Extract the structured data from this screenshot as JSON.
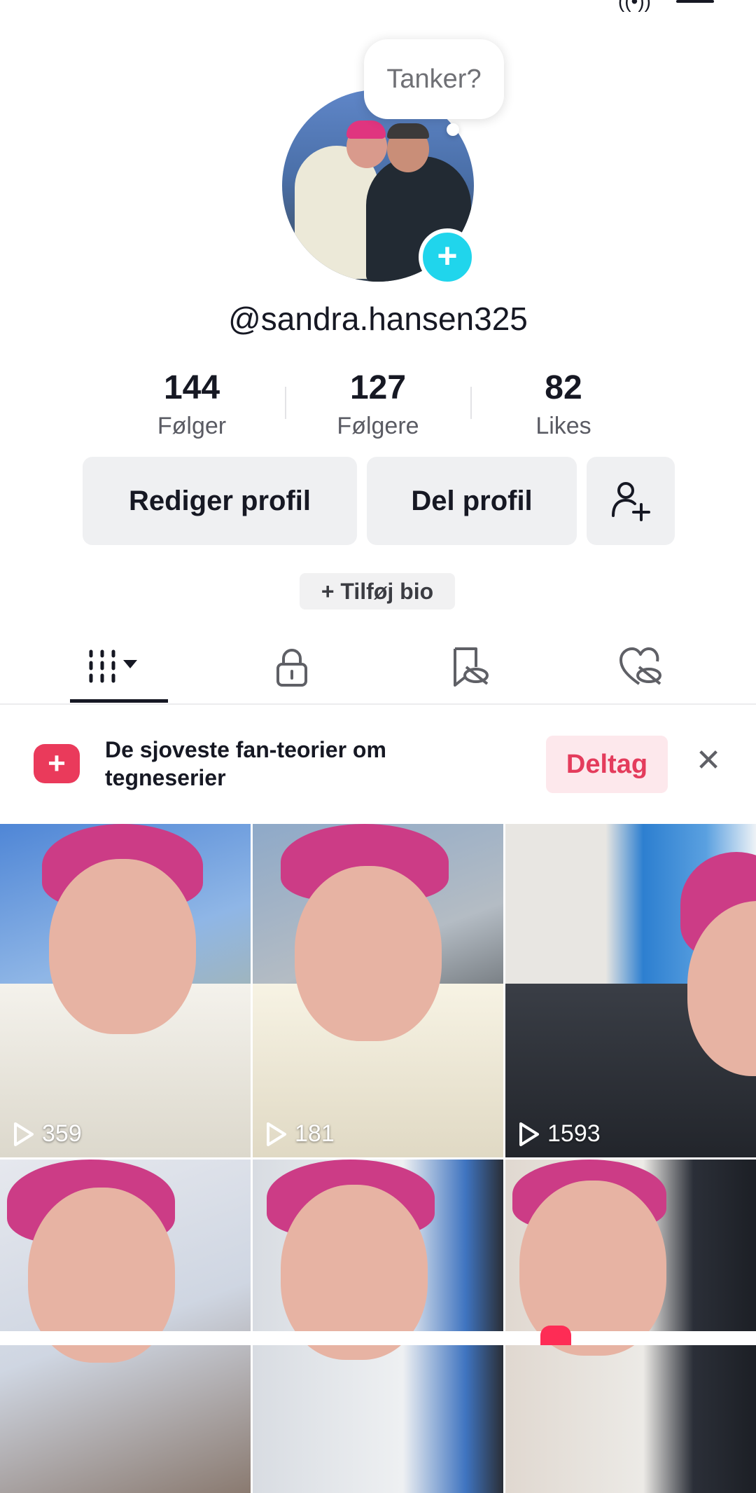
{
  "thought_bubble": {
    "text": "Tanker?"
  },
  "profile": {
    "username": "@sandra.hansen325"
  },
  "stats": [
    {
      "value": "144",
      "label": "Følger"
    },
    {
      "value": "127",
      "label": "Følgere"
    },
    {
      "value": "82",
      "label": "Likes"
    }
  ],
  "actions": {
    "edit_label": "Rediger profil",
    "share_label": "Del profil",
    "add_bio_label": "+ Tilføj bio"
  },
  "tabs": [
    {
      "icon": "videos-grid-icon",
      "selected": true
    },
    {
      "icon": "lock-icon",
      "selected": false
    },
    {
      "icon": "bookmark-hidden-icon",
      "selected": false
    },
    {
      "icon": "heart-hidden-icon",
      "selected": false
    }
  ],
  "banner": {
    "text": "De sjoveste fan-teorier om tegneserier",
    "join_label": "Deltag",
    "icon": "add-video-icon",
    "close_icon": "close-icon"
  },
  "videos": [
    {
      "views": "359"
    },
    {
      "views": "181"
    },
    {
      "views": "1593"
    },
    {
      "views": ""
    },
    {
      "views": ""
    },
    {
      "views": ""
    }
  ],
  "colors": {
    "accent": "#fe2c55",
    "teal": "#20d5ec",
    "text": "#161823",
    "button_bg": "#eff0f2"
  }
}
